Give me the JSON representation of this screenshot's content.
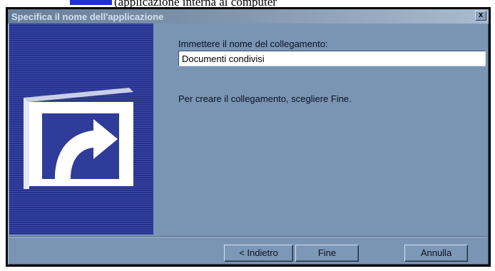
{
  "page_fragment": {
    "text": "(applicazione interna al computer"
  },
  "window": {
    "title": "Specifica il nome dell'applicazione",
    "close_symbol": "x"
  },
  "banner": {
    "icon": "shortcut-arrow-icon",
    "colors": {
      "background": "#2f3c9a",
      "icon": "#ffffff"
    }
  },
  "form": {
    "name_label": "Immettere il nome del collegamento:",
    "name_value": "Documenti condivisi",
    "hint": "Per creare il collegamento, scegliere Fine."
  },
  "buttons": {
    "back": "< Indietro",
    "finish": "Fine",
    "cancel": "Annulla"
  },
  "colors": {
    "dialog_background": "#7a95b4",
    "title_text": "#d5e0ec"
  }
}
